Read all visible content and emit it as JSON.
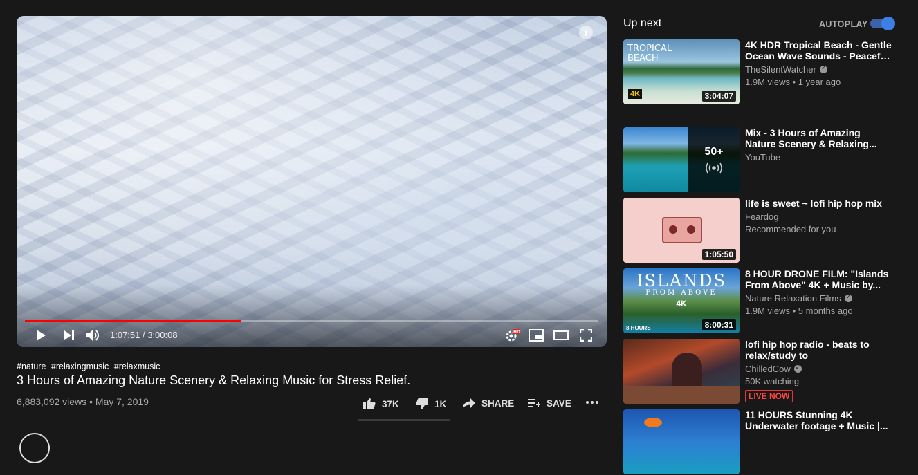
{
  "player": {
    "time_current": "1:07:51",
    "time_sep": " / ",
    "time_total": "3:00:08",
    "progress_fraction": 0.3775,
    "info_glyph": "i",
    "icons": [
      "play-icon",
      "next-icon",
      "volume-icon",
      "settings-hd-icon",
      "miniplayer-icon",
      "theater-mode-icon",
      "fullscreen-icon",
      "info-icon"
    ]
  },
  "video": {
    "hashtags": [
      "#nature",
      "#relaxingmusic",
      "#relaxmusic"
    ],
    "title": "3 Hours of Amazing Nature Scenery & Relaxing Music for Stress Relief.",
    "views": "6,883,092 views",
    "dot": "•",
    "date": "May 7, 2019",
    "likes": "37K",
    "dislikes": "1K",
    "share_label": "SHARE",
    "save_label": "SAVE"
  },
  "sidebar": {
    "heading": "Up next",
    "autoplay_label": "AUTOPLAY",
    "autoplay_on": true,
    "items": [
      {
        "title_line1": "4K HDR Tropical Beach - Gentle",
        "title_line2": "Ocean Wave Sounds - Peacefu...",
        "channel": "TheSilentWatcher",
        "verified": true,
        "info": "1.9M views • 1 year ago",
        "duration": "3:04:07",
        "thumb_text": "TROPICAL BEACH",
        "thumb_badge": "4K"
      },
      {
        "title_line1": "Mix - 3 Hours of Amazing",
        "title_line2": "Nature Scenery & Relaxing...",
        "channel": "YouTube",
        "verified": false,
        "info": "",
        "overlay_count": "50+",
        "overlay_icon": "radio-icon"
      },
      {
        "title_line1": "life is sweet ~ lofi hip hop mix",
        "title_line2": "",
        "channel": "Feardog",
        "verified": false,
        "info": "Recommended for you",
        "duration": "1:05:50"
      },
      {
        "title_line1": "8 HOUR DRONE FILM: \"Islands",
        "title_line2": "From Above\" 4K + Music by...",
        "channel": "Nature Relaxation Films",
        "verified": true,
        "info": "1.9M views • 5 months ago",
        "duration": "8:00:31",
        "thumb_title": "ISLANDS",
        "thumb_subtitle": "FROM ABOVE",
        "thumb_badge": "4K",
        "thumb_hours": "8 HOURS"
      },
      {
        "title_line1": "lofi hip hop radio - beats to",
        "title_line2": "relax/study to",
        "channel": "ChilledCow",
        "verified": true,
        "info": "50K watching",
        "live_label": "LIVE NOW"
      },
      {
        "title_line1": "11 HOURS Stunning 4K",
        "title_line2": "Underwater footage + Music |...",
        "channel": "",
        "verified": false,
        "info": ""
      }
    ]
  },
  "colors": {
    "background": "#181818",
    "progress": "#ff0000",
    "toggle": "#3e7fe5",
    "live": "#ff4444",
    "secondary_text": "#aaaaaa"
  }
}
